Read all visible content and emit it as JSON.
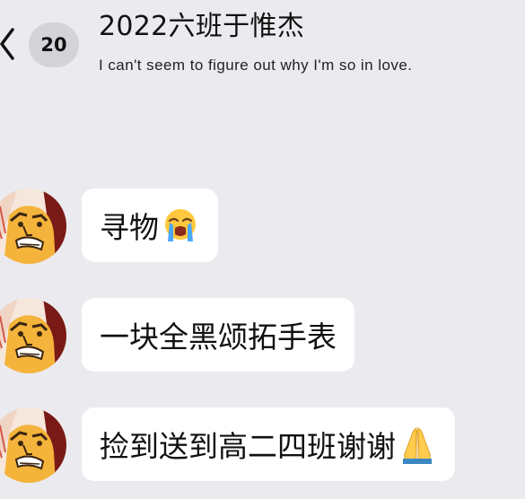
{
  "header": {
    "back_icon": "chevron-left-icon",
    "unread_count": "20",
    "title": "2022六班于惟杰",
    "subtitle": "I can't seem to figure out why I'm so in love."
  },
  "messages": [
    {
      "text": "寻物",
      "emoji": "loudly-crying-face-emoji"
    },
    {
      "text": "一块全黑颂拓手表",
      "emoji": ""
    },
    {
      "text": "捡到送到高二四班谢谢",
      "emoji": "folded-hands-emoji"
    }
  ],
  "colors": {
    "background": "#ebebef",
    "bubble": "#ffffff",
    "badge": "#d4d4d8"
  }
}
